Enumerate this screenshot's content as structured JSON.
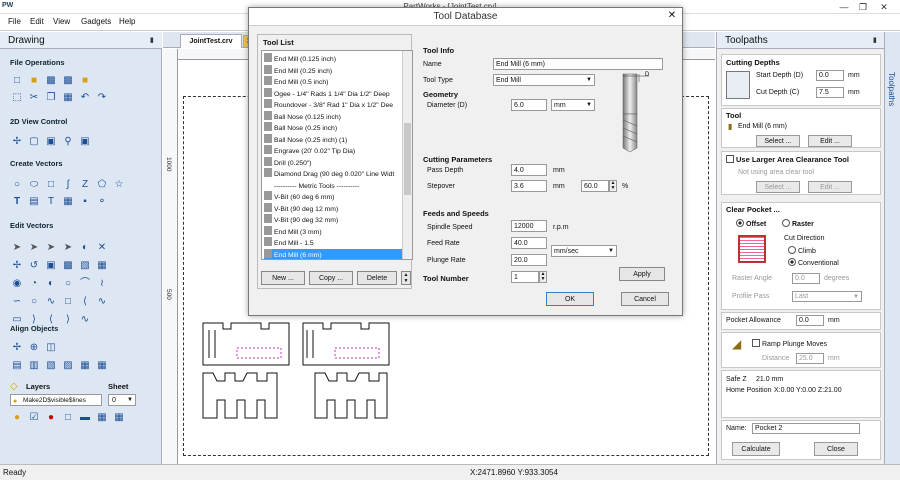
{
  "window": {
    "app_icon_text": "PW",
    "title": "PartWorks - [JointTest.crv]"
  },
  "menu": [
    "File",
    "Edit",
    "View",
    "Gadgets",
    "Help"
  ],
  "drawing_panel": {
    "title": "Drawing",
    "sections": [
      "File Operations",
      "2D View Control",
      "Create Vectors",
      "Edit Vectors",
      "Align Objects"
    ],
    "layers_label": "Layers",
    "sheet_label": "Sheet",
    "layer_value": "Make2D$visible$lines",
    "sheet_value": "0"
  },
  "document": {
    "tab_label": "JointTest.crv",
    "tab2_label": "3",
    "ruler_left_1000": "1000",
    "ruler_left_500": "500"
  },
  "toolpaths_panel": {
    "title": "Toolpaths",
    "side_tab": "Toolpaths",
    "cutting_depths": "Cutting Depths",
    "start_depth_label": "Start Depth (D)",
    "start_depth": "0.0",
    "cut_depth_label": "Cut Depth (C)",
    "cut_depth": "7.5",
    "unit": "mm",
    "tool_label": "Tool",
    "tool_name": "End Mill (6 mm)",
    "select": "Select ...",
    "edit": "Edit ...",
    "larger_clearance": "Use Larger Area Clearance Tool",
    "not_using": "Not using area clear tool",
    "clear_pocket": "Clear Pocket ...",
    "offset": "Offset",
    "raster": "Raster",
    "cut_direction": "Cut Direction",
    "climb": "Climb",
    "conventional": "Conventional",
    "raster_angle_label": "Raster Angle",
    "raster_angle": "0.0",
    "degrees": "degrees",
    "profile_pass_label": "Profile Pass",
    "profile_pass": "Last",
    "pocket_allowance_label": "Pocket Allowance",
    "pocket_allowance": "0.0",
    "ramp": "Ramp Plunge Moves",
    "distance_label": "Distance",
    "distance": "25.0",
    "safe_z_label": "Safe Z",
    "safe_z": "21.0 mm",
    "home_label": "Home Position",
    "home": "X:0.00 Y:0.00 Z:21.00",
    "name_label": "Name:",
    "name": "Pocket 2",
    "calculate": "Calculate",
    "close": "Close"
  },
  "dialog": {
    "title": "Tool Database",
    "tool_list_title": "Tool List",
    "tools": [
      "End Mill (0.125 inch)",
      "End Mill (0.25 inch)",
      "End Mill (0.5 inch)",
      "Ogee - 1/4\" Rads 1 1/4\" Dia 1/2\" Deep",
      "Roundover - 3/8\" Rad 1\" Dia x 1/2\" Dee",
      "Ball Nose (0.125 inch)",
      "Ball Nose (0.25 inch)",
      "Ball Nose (0.25 inch) (1)",
      "Engrave (20' 0.02\" Tip Dia)",
      "Drill (0.250\")",
      "Diamond Drag (90 deg 0.020\" Line Widt",
      "---------- Metric Tools ----------",
      "V-Bit (60 deg 6 mm)",
      "V-Bit (90 deg 12 mm)",
      "V-Bit (90 deg 32 mm)",
      "End Mill (3 mm)",
      "End Mill - 1.5",
      "End Mill (6 mm)"
    ],
    "selected_index": 17,
    "new": "New ...",
    "copy": "Copy ...",
    "delete": "Delete",
    "tool_info": "Tool Info",
    "name_label": "Name",
    "name": "End Mill (6 mm)",
    "tool_type_label": "Tool Type",
    "tool_type": "End Mill",
    "geometry": "Geometry",
    "diameter_label": "Diameter (D)",
    "diameter": "6.0",
    "diameter_unit": "mm",
    "cutting_params": "Cutting Parameters",
    "pass_depth_label": "Pass Depth",
    "pass_depth": "4.0",
    "stepover_label": "Stepover",
    "stepover": "3.6",
    "stepover_pct": "60.0",
    "mm": "mm",
    "pct": "%",
    "feeds": "Feeds and Speeds",
    "spindle_label": "Spindle Speed",
    "spindle": "12000",
    "rpm": "r.p.m",
    "feed_label": "Feed Rate",
    "feed": "40.0",
    "feed_unit": "mm/sec",
    "plunge_label": "Plunge Rate",
    "plunge": "20.0",
    "tool_number_label": "Tool Number",
    "tool_number": "1",
    "apply": "Apply",
    "ok": "OK",
    "cancel": "Cancel",
    "d_label": "D"
  },
  "status": {
    "left": "Ready",
    "coords": "X:2471.8960 Y:933.3054"
  }
}
